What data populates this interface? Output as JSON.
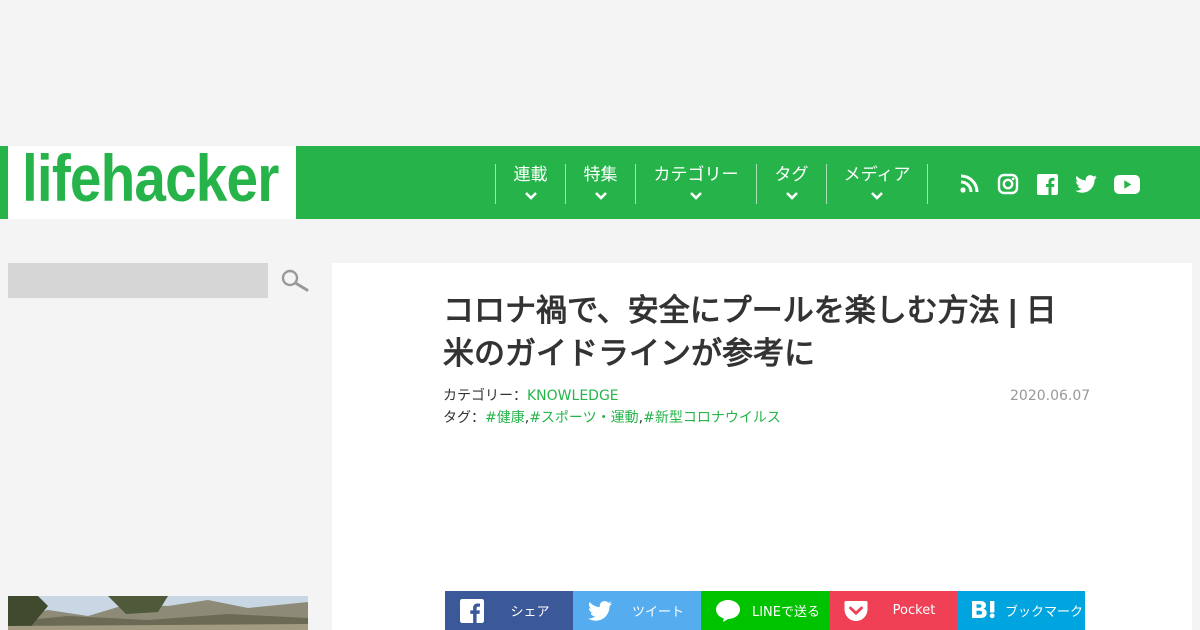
{
  "header": {
    "logo_text": "lifehacker",
    "brand_color": "#26b44a",
    "nav": [
      {
        "label": "連載"
      },
      {
        "label": "特集"
      },
      {
        "label": "カテゴリー"
      },
      {
        "label": "タグ"
      },
      {
        "label": "メディア"
      }
    ],
    "social_icons": [
      "rss-icon",
      "instagram-icon",
      "facebook-icon",
      "twitter-icon",
      "youtube-icon"
    ]
  },
  "sidebar": {
    "search": {
      "placeholder": "",
      "value": ""
    },
    "search_icon": "search-icon"
  },
  "article": {
    "title": "コロナ禍で、安全にプールを楽しむ方法 | 日米のガイドラインが参考に",
    "category_label": "カテゴリー：",
    "category": "KNOWLEDGE",
    "tag_label": "タグ：",
    "tags": [
      "#健康",
      "#スポーツ・運動",
      "#新型コロナウイルス"
    ],
    "tag_separator": ",",
    "date": "2020.06.07"
  },
  "share": [
    {
      "label": "シェア",
      "icon": "facebook-icon",
      "color": "#3b5998"
    },
    {
      "label": "ツイート",
      "icon": "twitter-icon",
      "color": "#55acee"
    },
    {
      "label": "LINEで送る",
      "icon": "line-icon",
      "color": "#00c300"
    },
    {
      "label": "Pocket",
      "icon": "pocket-icon",
      "color": "#ef4056"
    },
    {
      "label": "ブックマーク",
      "icon": "hatena-bookmark-icon",
      "color": "#00a4de"
    }
  ]
}
